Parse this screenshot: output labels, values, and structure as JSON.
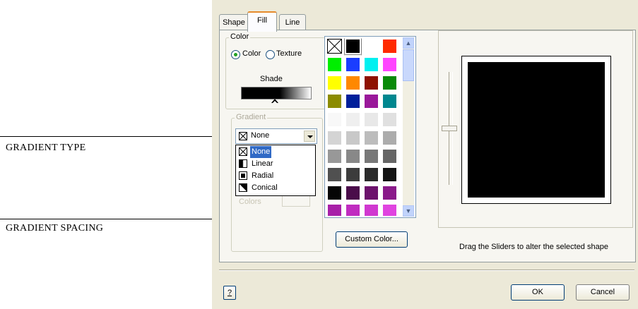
{
  "callouts": {
    "gradient_type": "GRADIENT TYPE",
    "gradient_spacing": "GRADIENT SPACING"
  },
  "tabs": [
    {
      "label": "Shape",
      "active": false
    },
    {
      "label": "Fill",
      "active": true
    },
    {
      "label": "Line",
      "active": false
    }
  ],
  "color_group": {
    "legend": "Color",
    "radio_color": "Color",
    "radio_texture": "Texture",
    "selected": "Color",
    "shade_label": "Shade"
  },
  "gradient_group": {
    "legend": "Gradient",
    "selected": "None",
    "options": [
      {
        "label": "None",
        "icon": "no-fill-icon"
      },
      {
        "label": "Linear",
        "icon": "linear-gradient-icon"
      },
      {
        "label": "Radial",
        "icon": "radial-gradient-icon"
      },
      {
        "label": "Conical",
        "icon": "conical-gradient-icon"
      }
    ],
    "colors_label": "Colors"
  },
  "palette": {
    "colors": [
      "none",
      "#000000",
      "#ffffff",
      "#ff2a00",
      "#00ee00",
      "#1a3dff",
      "#00f0f0",
      "#ff44ff",
      "#ffff00",
      "#ff8800",
      "#8e1100",
      "#088a08",
      "#8c8c00",
      "#001f9a",
      "#9a189a",
      "#00878f",
      "#f8f8f8",
      "#efefef",
      "#e8e8e8",
      "#e0e0e0",
      "#d4d4d4",
      "#c8c8c8",
      "#bcbcbc",
      "#acacac",
      "#989898",
      "#888888",
      "#787878",
      "#666666",
      "#505050",
      "#3c3c3c",
      "#2a2a2a",
      "#141414",
      "#060606",
      "#4a0c4a",
      "#6c126c",
      "#8a1a8a",
      "#a820a8",
      "#c02cc0",
      "#d038d0",
      "#e044e0"
    ],
    "custom_color_button": "Custom Color..."
  },
  "preview": {
    "fill_color": "#000000",
    "hint": "Drag the Sliders to alter the selected shape"
  },
  "footer": {
    "help_label": "?",
    "ok_label": "OK",
    "cancel_label": "Cancel"
  }
}
